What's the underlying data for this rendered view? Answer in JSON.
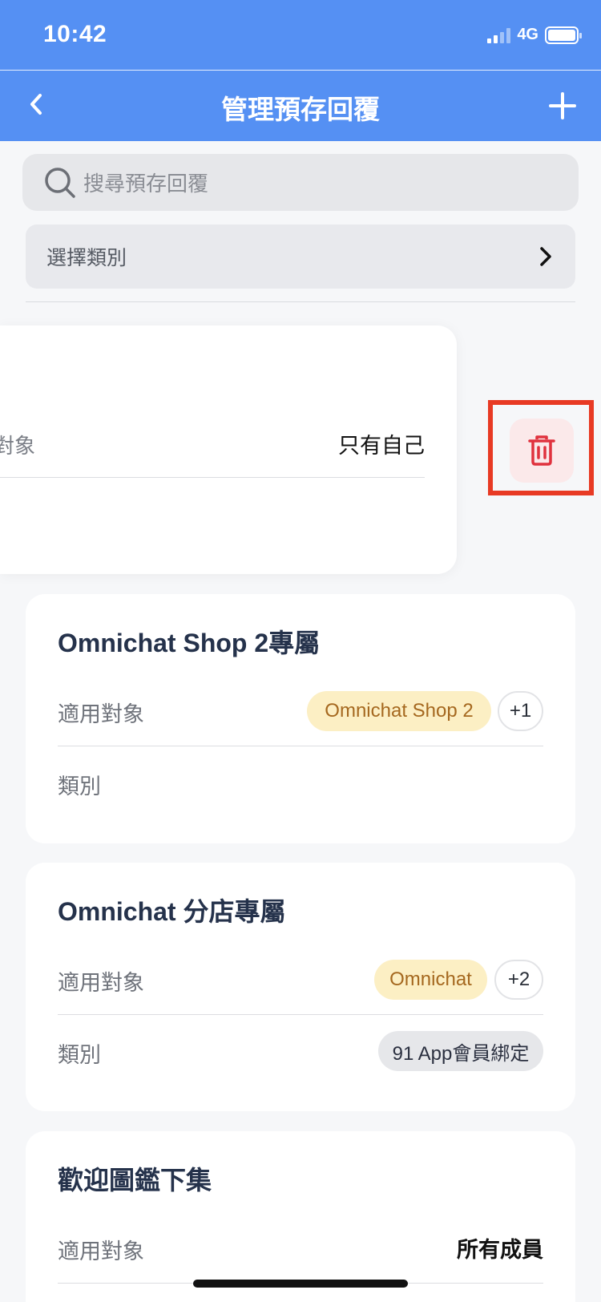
{
  "status": {
    "time": "10:42",
    "network": "4G"
  },
  "nav": {
    "title": "管理預存回覆"
  },
  "search": {
    "placeholder": "搜尋預存回覆"
  },
  "filter": {
    "category_label": "選擇類別"
  },
  "swiped_item": {
    "partial_label": "對象",
    "audience_value": "只有自己"
  },
  "cards": [
    {
      "title": "Omnichat Shop 2專屬",
      "audience_label": "適用對象",
      "audience_chip": "Omnichat Shop 2",
      "audience_more": "+1",
      "category_label": "類別"
    },
    {
      "title": "Omnichat 分店專屬",
      "audience_label": "適用對象",
      "audience_chip": "Omnichat",
      "audience_more": "+2",
      "category_label": "類別",
      "category_chip": "91 App會員綁定"
    },
    {
      "title": "歡迎圖鑑下集",
      "audience_label": "適用對象",
      "audience_value": "所有成員"
    }
  ],
  "colors": {
    "header": "#5590f3",
    "delete_bg": "#fbe9ea",
    "delete_icon": "#e0323e",
    "highlight": "#e83a24"
  },
  "icons": [
    "back-chevron-icon",
    "plus-icon",
    "search-icon",
    "chevron-right-icon",
    "trash-icon"
  ]
}
